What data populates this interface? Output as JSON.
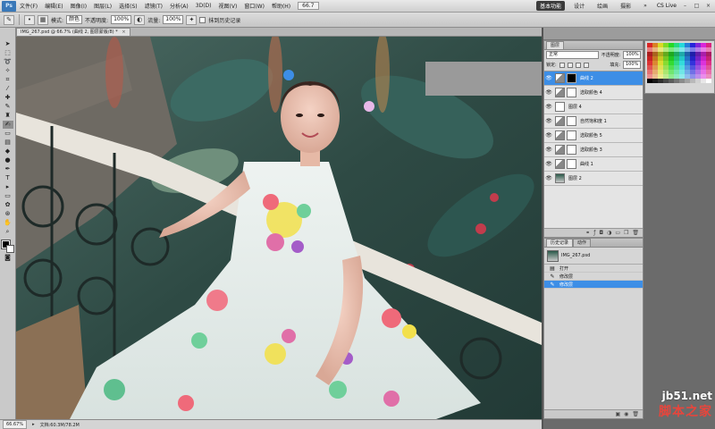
{
  "menubar": {
    "logo": "Ps",
    "items": [
      "文件(F)",
      "编辑(E)",
      "图像(I)",
      "图层(L)",
      "选择(S)",
      "滤镜(T)",
      "分析(A)",
      "3D(D)",
      "视图(V)",
      "窗口(W)",
      "帮助(H)"
    ],
    "zoom": "66.7",
    "workspaces": [
      "基本功能",
      "设计",
      "绘画",
      "摄影"
    ],
    "cs_live": "CS Live"
  },
  "options": {
    "mode_label": "模式:",
    "mode_value": "颜色",
    "opacity_label": "不透明度:",
    "opacity_value": "100%",
    "flow_label": "流量:",
    "flow_value": "100%",
    "history_label": "抹到历史记录"
  },
  "document": {
    "tab_title": "IMG_267.psd @ 66.7% (曲线 2, 图层蒙版/8) *",
    "zoom_status": "66.67%",
    "doc_status": "文档:60.3M/78.2M"
  },
  "layers_panel": {
    "tab": "图层",
    "blend_mode": "正常",
    "opacity_label": "不透明度:",
    "opacity_value": "100%",
    "lock_label": "锁定:",
    "fill_label": "填充:",
    "fill_value": "100%",
    "layers": [
      {
        "name": "曲线 2",
        "thumb": "adj",
        "mask": "black",
        "selected": true
      },
      {
        "name": "选取颜色 4",
        "thumb": "adj",
        "mask": "white",
        "selected": false
      },
      {
        "name": "图层 4",
        "thumb": "plain",
        "mask": "none",
        "selected": false
      },
      {
        "name": "自然饱和度 1",
        "thumb": "adj",
        "mask": "white",
        "selected": false
      },
      {
        "name": "选取颜色 5",
        "thumb": "adj",
        "mask": "white",
        "selected": false
      },
      {
        "name": "选取颜色 3",
        "thumb": "adj",
        "mask": "white",
        "selected": false
      },
      {
        "name": "曲线 1",
        "thumb": "adj",
        "mask": "white",
        "selected": false
      },
      {
        "name": "图层 2",
        "thumb": "img",
        "mask": "none",
        "selected": false
      }
    ]
  },
  "history_panel": {
    "tabs": [
      "历史记录",
      "动作"
    ],
    "snapshot": "IMG_267.psd",
    "states": [
      {
        "label": "打开",
        "selected": false
      },
      {
        "label": "修改层",
        "selected": false
      },
      {
        "label": "修改层",
        "selected": true
      }
    ]
  },
  "watermark": {
    "site": "jb51.net",
    "name": "脚本之家"
  },
  "colors": {
    "selection": "#3d8ee6",
    "panel_bg": "#d6d6d6"
  }
}
